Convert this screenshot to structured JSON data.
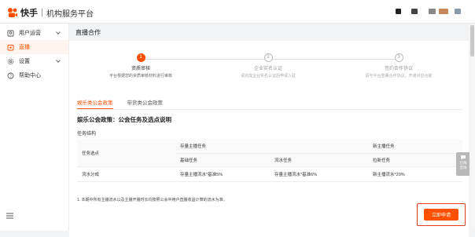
{
  "header": {
    "logo_text": "快手",
    "platform_name": "机构服务平台",
    "colors": {
      "brand": "#ff5000"
    }
  },
  "sidebar": {
    "items": [
      {
        "label": "用户运营",
        "icon": "user-icon",
        "expandable": true,
        "active": false
      },
      {
        "label": "直播",
        "icon": "live-icon",
        "expandable": false,
        "active": true
      },
      {
        "label": "设置",
        "icon": "gear-icon",
        "expandable": true,
        "active": false
      },
      {
        "label": "帮助中心",
        "icon": "help-icon",
        "expandable": false,
        "active": false
      }
    ],
    "bottom_icon": "menu-icon"
  },
  "page": {
    "title": "直播合作"
  },
  "steps": [
    {
      "number": "1",
      "title": "资质审核",
      "desc": "平台根据您的资质审核材料进行审核",
      "status": "current"
    },
    {
      "number": "2",
      "title": "企业实名认证",
      "desc": "请完成企业实名认证后申请入驻",
      "status": "pending"
    },
    {
      "number": "3",
      "title": "签约合作协议",
      "desc": "请与平台签署合作协议，开通对应功能",
      "status": "pending"
    }
  ],
  "tabs": [
    {
      "label": "娱乐类公会政策",
      "active": true
    },
    {
      "label": "带货类公会政策",
      "active": false
    }
  ],
  "section": {
    "title": "娱乐公会政策：公会任务及选点说明",
    "sub_title": "任务结构"
  },
  "table": {
    "col_task_point": "任务选点",
    "col_existing_group": "存量主播任务",
    "col_new_group": "新主播任务",
    "col_base_task": "基础任务",
    "col_water_task": "流水任务",
    "col_new_task": "拉新任务",
    "row_label": "流水分成",
    "cell_base": "存量主播流水*基准5%",
    "cell_water": "存量主播流水*基准6%",
    "cell_new": "新主播流水*20%"
  },
  "note": "1. 本期中所有主播流水以及主播开播时长均按照公会中用户直播收益计算的流水为准。",
  "buttons": {
    "apply": "立即申请"
  },
  "float_help": {
    "line1": "在线",
    "line2": "咨询"
  }
}
